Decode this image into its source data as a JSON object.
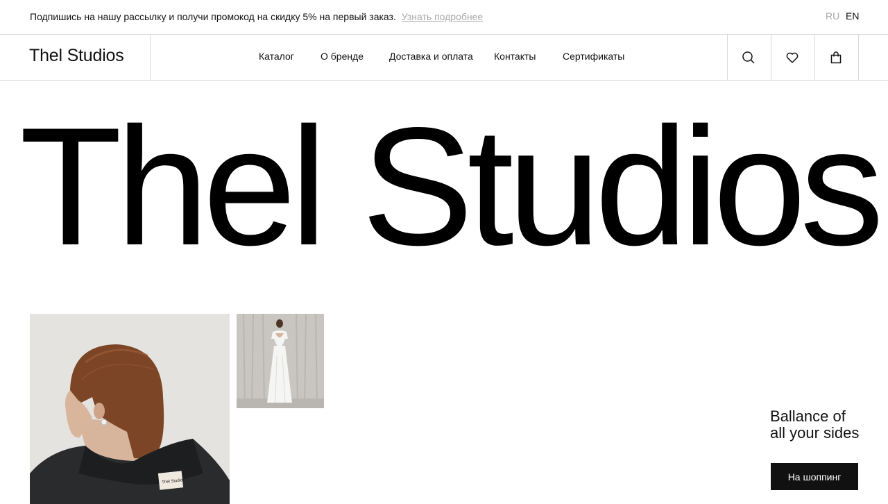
{
  "topbar": {
    "promo_text": "Подпишись на нашу рассылку и получи промокод на скидку 5% на первый заказ.",
    "promo_link": "Узнать подробнее",
    "lang_ru": "RU",
    "lang_en": "EN"
  },
  "header": {
    "logo": "Thel Studios",
    "nav": [
      "Каталог",
      "О бренде",
      "Доставка и оплата",
      "Контакты",
      "Сертификаты"
    ],
    "icons": [
      "search-icon",
      "heart-icon",
      "bag-icon"
    ]
  },
  "hero": {
    "title": "Thel Studios",
    "tagline_line1": "Ballance of",
    "tagline_line2": "all your sides",
    "cta_label": "На шоппинг"
  },
  "colors": {
    "text": "#111111",
    "muted": "#a8a8a8",
    "divider": "#d9d9d9",
    "button_bg": "#111111"
  }
}
